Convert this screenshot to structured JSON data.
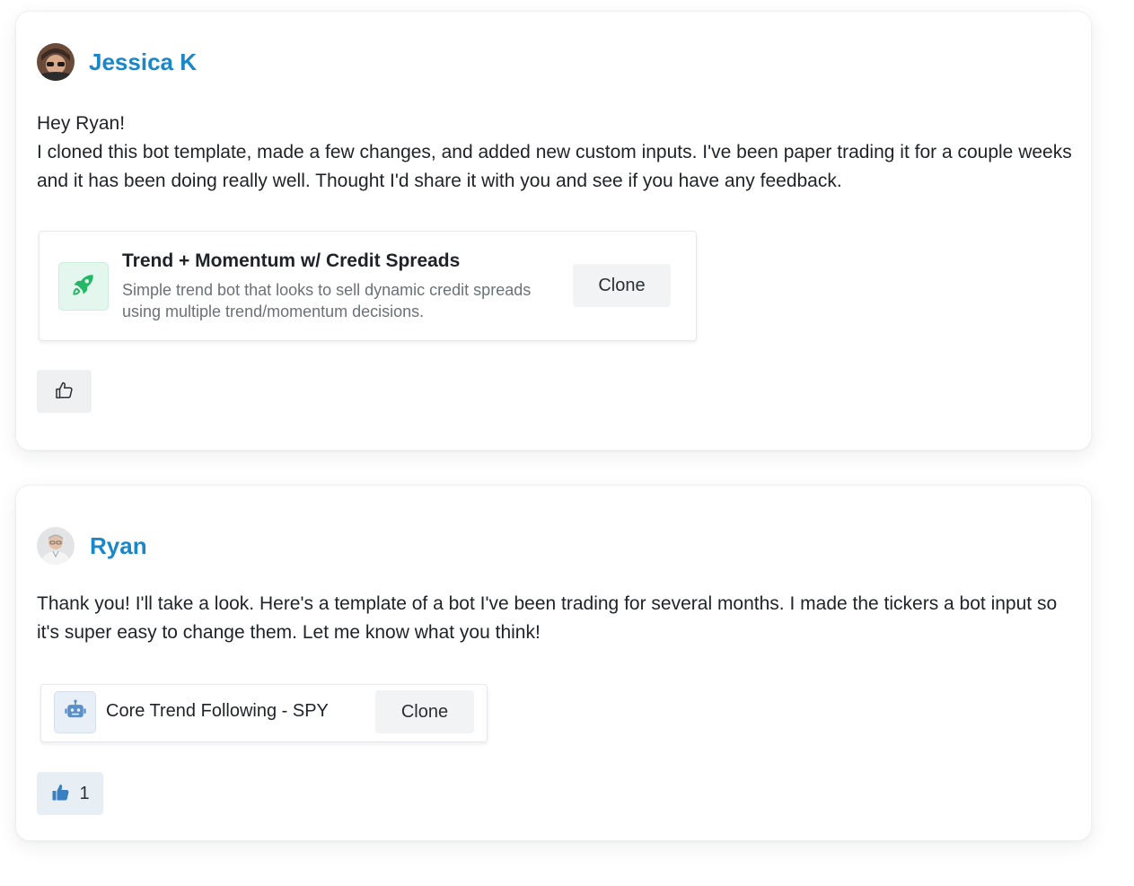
{
  "thread": {
    "posts": [
      {
        "author": "Jessica K",
        "avatar_icon": "user-photo-avatar",
        "message_lines": [
          "Hey Ryan!",
          "I cloned this bot template, made a few changes, and added new custom inputs. I've been paper trading it for a couple weeks and it has been doing really well. Thought I'd share it with you and see if you have any feedback."
        ],
        "bot": {
          "icon": "rocket-icon",
          "title": "Trend + Momentum w/ Credit Spreads",
          "description": "Simple trend bot that looks to sell dynamic credit spreads using multiple trend/momentum decisions.",
          "clone_label": "Clone"
        },
        "like": {
          "icon": "thumbs-up-outline-icon",
          "liked": false
        }
      },
      {
        "author": "Ryan",
        "avatar_icon": "user-photo-avatar",
        "message_lines": [
          "Thank you! I'll take a look. Here's a template of a bot I've been trading for several months. I made the tickers a bot input so it's super easy to change them. Let me know what you think!"
        ],
        "bot": {
          "icon": "robot-icon",
          "title": "Core Trend Following - SPY",
          "clone_label": "Clone"
        },
        "like": {
          "icon": "thumbs-up-filled-icon",
          "liked": true,
          "count": "1"
        }
      }
    ]
  },
  "colors": {
    "author_name": "#1a87c8",
    "rocket_green": "#22b866",
    "robot_blue": "#5b8fc9",
    "thumb_filled": "#3a7fbf"
  }
}
